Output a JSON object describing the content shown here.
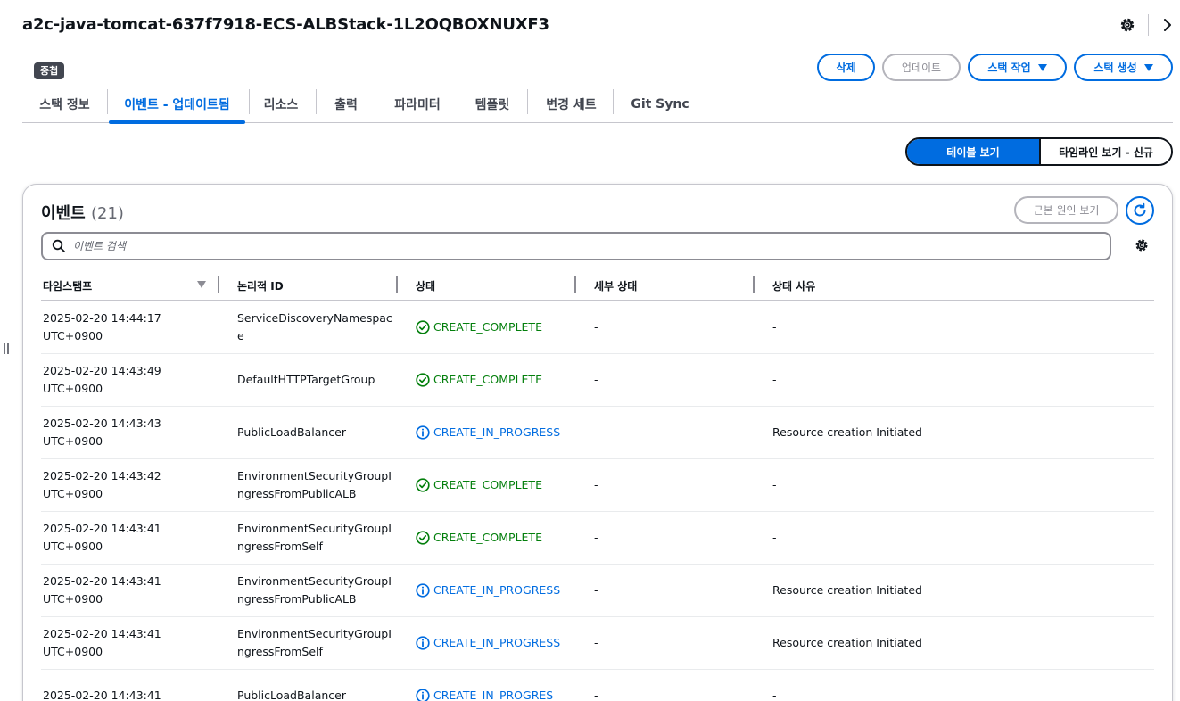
{
  "header": {
    "stack_title": "a2c-java-tomcat-637f7918-ECS-ALBStack-1L2OQBOXNUXF3",
    "nested_badge": "중첩",
    "buttons": {
      "delete": "삭제",
      "update": "업데이트",
      "stack_actions": "스택 작업",
      "create_stack": "스택 생성"
    }
  },
  "tabs": [
    {
      "label": "스택 정보",
      "active": false
    },
    {
      "label": "이벤트 - 업데이트됨",
      "active": true
    },
    {
      "label": "리소스",
      "active": false
    },
    {
      "label": "출력",
      "active": false
    },
    {
      "label": "파라미터",
      "active": false
    },
    {
      "label": "템플릿",
      "active": false
    },
    {
      "label": "변경 세트",
      "active": false
    },
    {
      "label": "Git Sync",
      "active": false
    }
  ],
  "view_toggle": {
    "table_view": "테이블 보기",
    "timeline_view": "타임라인 보기 - 신규",
    "selected": "table_view"
  },
  "events_panel": {
    "title": "이벤트",
    "count": "(21)",
    "root_cause_button": "근본 원인 보기",
    "search_placeholder": "이벤트 검색",
    "columns": {
      "timestamp": "타임스탬프",
      "logical_id": "논리적 ID",
      "status": "상태",
      "detailed_status": "세부 상태",
      "status_reason": "상태 사유"
    },
    "rows": [
      {
        "timestamp": "2025-02-20 14:44:17 UTC+0900",
        "logical_id": "ServiceDiscoveryNamespace",
        "status": "CREATE_COMPLETE",
        "status_kind": "complete",
        "detailed_status": "-",
        "status_reason": "-"
      },
      {
        "timestamp": "2025-02-20 14:43:49 UTC+0900",
        "logical_id": "DefaultHTTPTargetGroup",
        "status": "CREATE_COMPLETE",
        "status_kind": "complete",
        "detailed_status": "-",
        "status_reason": "-"
      },
      {
        "timestamp": "2025-02-20 14:43:43 UTC+0900",
        "logical_id": "PublicLoadBalancer",
        "status": "CREATE_IN_PROGRESS",
        "status_kind": "in_progress",
        "detailed_status": "-",
        "status_reason": "Resource creation Initiated"
      },
      {
        "timestamp": "2025-02-20 14:43:42 UTC+0900",
        "logical_id": "EnvironmentSecurityGroupIngressFromPublicALB",
        "status": "CREATE_COMPLETE",
        "status_kind": "complete",
        "detailed_status": "-",
        "status_reason": "-"
      },
      {
        "timestamp": "2025-02-20 14:43:41 UTC+0900",
        "logical_id": "EnvironmentSecurityGroupIngressFromSelf",
        "status": "CREATE_COMPLETE",
        "status_kind": "complete",
        "detailed_status": "-",
        "status_reason": "-"
      },
      {
        "timestamp": "2025-02-20 14:43:41 UTC+0900",
        "logical_id": "EnvironmentSecurityGroupIngressFromPublicALB",
        "status": "CREATE_IN_PROGRESS",
        "status_kind": "in_progress",
        "detailed_status": "-",
        "status_reason": "Resource creation Initiated"
      },
      {
        "timestamp": "2025-02-20 14:43:41 UTC+0900",
        "logical_id": "EnvironmentSecurityGroupIngressFromSelf",
        "status": "CREATE_IN_PROGRESS",
        "status_kind": "in_progress",
        "detailed_status": "-",
        "status_reason": "Resource creation Initiated"
      },
      {
        "timestamp": "2025-02-20 14:43:41",
        "logical_id": "PublicLoadBalancer",
        "status": "CREATE_IN_PROGRES",
        "status_kind": "in_progress",
        "detailed_status": "-",
        "status_reason": "-"
      }
    ]
  },
  "colors": {
    "primary": "#006ce0",
    "success": "#037f0c",
    "text": "#0f141a",
    "border": "#c6c6cd"
  }
}
